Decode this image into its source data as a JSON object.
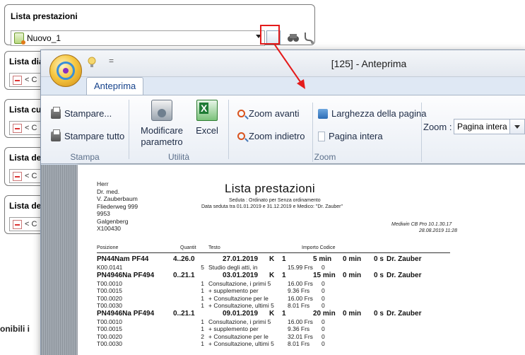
{
  "background": {
    "panel_title": "Lista prestazioni",
    "combo_value": "Nuovo_1",
    "side_panels": [
      {
        "title": "Lista dia",
        "combo": "< C"
      },
      {
        "title": "Lista cu",
        "combo": "< C"
      },
      {
        "title": "Lista de",
        "combo": "< C"
      },
      {
        "title": "Lista de",
        "combo": "< C"
      }
    ],
    "bottom_text": "onibili i"
  },
  "window": {
    "title": "[125] - Anteprima",
    "qat_sep": "="
  },
  "ribbon": {
    "tab": "Anteprima",
    "groups": {
      "stampa": {
        "label": "Stampa",
        "print": "Stampare...",
        "print_all": "Stampare tutto"
      },
      "utilita": {
        "label": "Utilità",
        "modify_line1": "Modificare",
        "modify_line2": "parametro",
        "excel": "Excel"
      },
      "zoom": {
        "label": "Zoom",
        "zoom_in": "Zoom avanti",
        "zoom_out": "Zoom indietro",
        "page_width": "Larghezza della pagina",
        "full_page": "Pagina intera",
        "zoom_label": "Zoom :",
        "zoom_value": "Pagina intera"
      }
    }
  },
  "report": {
    "address": "Herr\nDr. med.\nV. Zauberbaum\nFliederweg 999\n9953\nGalgenberg\nX100430",
    "title": "Lista prestazioni",
    "subtitle1": "Seduta : Ordinato per Senza ordinamento",
    "subtitle2": "Data seduta tra 01.01.2019 e 31.12.2019 e Medico: \"Dr. Zauber\"",
    "software": "Mediwin CB Pro 10.1.30.17",
    "printed": "28.08.2019 11:28",
    "headers": {
      "pos": "Posizione",
      "qty": "Quantit",
      "text": "Testo",
      "imp": "Importo Codice"
    },
    "groups": [
      {
        "header": {
          "pos": "PN44Nam PF44",
          "qty": "4..26.0",
          "date": "27.01.2019",
          "k": "K",
          "n": "1",
          "m1": "5 min",
          "m2": "0 min",
          "s": "0 s",
          "doc": "Dr. Zauber"
        },
        "lines": [
          {
            "pos": "K00.0141",
            "qty": "5",
            "text": "Studio degli atti, in",
            "imp": "15.99 Frs",
            "ks": "0"
          }
        ]
      },
      {
        "header": {
          "pos": "PN4946Na PF494",
          "qty": "0..21.1",
          "date": "03.01.2019",
          "k": "K",
          "n": "1",
          "m1": "15 min",
          "m2": "0 min",
          "s": "0 s",
          "doc": "Dr. Zauber"
        },
        "lines": [
          {
            "pos": "T00.0010",
            "qty": "1",
            "text": "Consultazione, i primi 5",
            "imp": "16.00 Frs",
            "ks": "0"
          },
          {
            "pos": "T00.0015",
            "qty": "1",
            "text": "+ supplemento per",
            "imp": "9.36 Frs",
            "ks": "0"
          },
          {
            "pos": "T00.0020",
            "qty": "1",
            "text": "+ Consultazione per le",
            "imp": "16.00 Frs",
            "ks": "0"
          },
          {
            "pos": "T00.0030",
            "qty": "1",
            "text": "+ Consultazione, ultimi 5",
            "imp": "8.01 Frs",
            "ks": "0"
          }
        ]
      },
      {
        "header": {
          "pos": "PN4946Na PF494",
          "qty": "0..21.1",
          "date": "09.01.2019",
          "k": "K",
          "n": "1",
          "m1": "20 min",
          "m2": "0 min",
          "s": "0 s",
          "doc": "Dr. Zauber"
        },
        "lines": [
          {
            "pos": "T00.0010",
            "qty": "1",
            "text": "Consultazione, i primi 5",
            "imp": "16.00 Frs",
            "ks": "0"
          },
          {
            "pos": "T00.0015",
            "qty": "1",
            "text": "+ supplemento per",
            "imp": "9.36 Frs",
            "ks": "0"
          },
          {
            "pos": "T00.0020",
            "qty": "2",
            "text": "+ Consultazione per le",
            "imp": "32.01 Frs",
            "ks": "0"
          },
          {
            "pos": "T00.0030",
            "qty": "1",
            "text": "+ Consultazione, ultimi 5",
            "imp": "8.01 Frs",
            "ks": "0"
          }
        ]
      }
    ]
  },
  "colors": {
    "highlight": "#e41b1b",
    "ribbon_text": "#1d2b45"
  }
}
